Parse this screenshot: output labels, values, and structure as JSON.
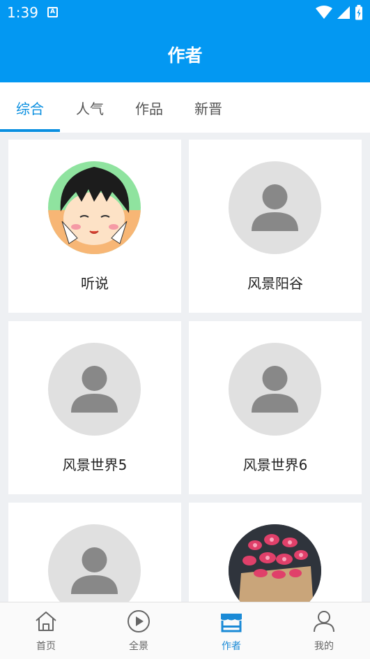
{
  "status_bar": {
    "time": "1:39",
    "notification_glyph": "A"
  },
  "app_bar": {
    "title": "作者"
  },
  "tabs": [
    {
      "label": "综合",
      "active": true
    },
    {
      "label": "人气",
      "active": false
    },
    {
      "label": "作品",
      "active": false
    },
    {
      "label": "新晋",
      "active": false
    }
  ],
  "authors": [
    {
      "name": "听说",
      "avatar": "cartoon-girl-avatar"
    },
    {
      "name": "风景阳谷",
      "avatar": "default-person-avatar"
    },
    {
      "name": "风景世界5",
      "avatar": "default-person-avatar"
    },
    {
      "name": "风景世界6",
      "avatar": "default-person-avatar"
    },
    {
      "name": "",
      "avatar": "default-person-avatar"
    },
    {
      "name": "",
      "avatar": "succulent-plant-photo-avatar"
    }
  ],
  "bottom_nav": [
    {
      "label": "首页",
      "icon": "home-icon",
      "active": false
    },
    {
      "label": "全景",
      "icon": "play-circle-icon",
      "active": false
    },
    {
      "label": "作者",
      "icon": "store-icon",
      "active": true
    },
    {
      "label": "我的",
      "icon": "person-icon",
      "active": false
    }
  ],
  "colors": {
    "primary": "#0398f2",
    "tab_active": "#0a8fe0",
    "nav_active": "#1a8ad6",
    "background": "#eef0f3"
  }
}
